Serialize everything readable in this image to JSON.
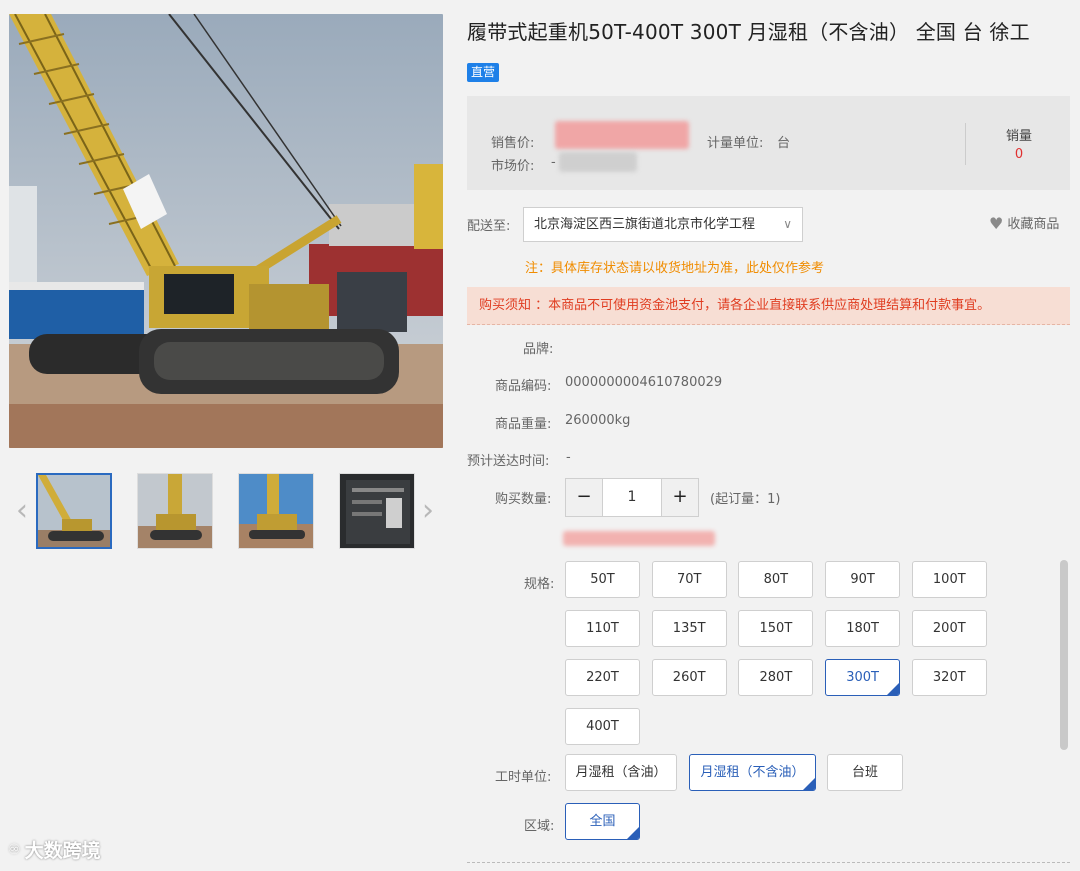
{
  "product": {
    "title": "履带式起重机50T-400T 300T 月湿租（不含油） 全国 台 徐工",
    "tag": "直营"
  },
  "gallery": {
    "prev_arrow": "‹",
    "next_arrow": "›"
  },
  "price": {
    "sale_label": "销售价:",
    "market_label": "市场价:",
    "market_prefix": "-",
    "unit_label": "计量单位:",
    "unit_value": "台",
    "sales_label": "销量",
    "sales_value": "0"
  },
  "delivery": {
    "label": "配送至:",
    "address": "北京海淀区西三旗街道北京市化学工程",
    "caret": "∨",
    "favorite": "收藏商品",
    "note": "注：具体库存状态请以收货地址为准，此处仅作参考"
  },
  "notice": "购买须知 ：本商品不可使用资金池支付，请各企业直接联系供应商处理结算和付款事宜。",
  "details": {
    "brand_label": "品牌:",
    "code_label": "商品编码:",
    "code_value": "0000000004610780029",
    "weight_label": "商品重量:",
    "weight_value": "260000kg",
    "eta_label": "预计送达时间:",
    "eta_value": "-"
  },
  "quantity": {
    "label": "购买数量:",
    "minus": "−",
    "value": "1",
    "plus": "+",
    "min_order": "(起订量：1)"
  },
  "spec": {
    "label": "规格:",
    "options": [
      "50T",
      "70T",
      "80T",
      "90T",
      "100T",
      "110T",
      "135T",
      "150T",
      "180T",
      "200T",
      "220T",
      "260T",
      "280T",
      "300T",
      "320T",
      "400T"
    ],
    "selected": "300T"
  },
  "work_unit": {
    "label": "工时单位:",
    "options": [
      "月湿租（含油）",
      "月湿租（不含油）",
      "台班"
    ],
    "selected": "月湿租（不含油）"
  },
  "region": {
    "label": "区域:",
    "options": [
      "全国"
    ],
    "selected": "全国"
  },
  "watermark": "大数跨境",
  "colors": {
    "accent": "#2a5fb8",
    "tag": "#1e80e8",
    "notice_bg": "#f7ded4",
    "notice_text": "#e03c20",
    "note_text": "#f08c00",
    "sales_value": "#e03030"
  }
}
